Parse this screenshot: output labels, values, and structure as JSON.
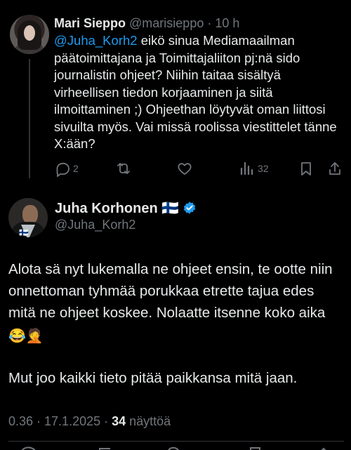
{
  "reply": {
    "author_name": "Mari Sieppo",
    "author_handle": "@marisieppo",
    "time": "10 h",
    "mention": "@Juha_Korh2",
    "text_after_mention": " eikö sinua Mediamaailman päätoimittajana ja Toimittajaliiton pj:nä sido journalistin ohjeet? Niihin taitaa sisältyä virheellisen tiedon korjaaminen ja siitä ilmoittaminen ;) Ohjeethan löytyvät oman liittosi sivuilta myös. Vai missä roolissa viestittelet tänne X:ään?",
    "reply_count": "2",
    "views_count": "32",
    "icons": [
      "reply-icon",
      "repost-icon",
      "like-icon",
      "views-icon",
      "bookmark-icon",
      "share-icon"
    ]
  },
  "main": {
    "author_name": "Juha Korhonen",
    "flag": "🇫🇮",
    "handle": "@Juha_Korh2",
    "paragraph1_text": "Alota sä nyt lukemalla ne ohjeet ensin, te ootte niin onnettoman tyhmää porukkaa etrette tajua edes mitä ne ohjeet koskee. Nolaatte itsenne koko aika",
    "paragraph1_emojis": "😂🤦",
    "paragraph2": "Mut joo kaikki tieto pitää paikkansa mitä jaan.",
    "time_date": "0.36 · 17.1.2025 · ",
    "views_number": "34",
    "views_label": " näyttöä"
  },
  "colors": {
    "background": "#000000",
    "text": "#e7e9ea",
    "secondary": "#71767b",
    "accent": "#1d9bf0",
    "divider": "#2f3336"
  }
}
